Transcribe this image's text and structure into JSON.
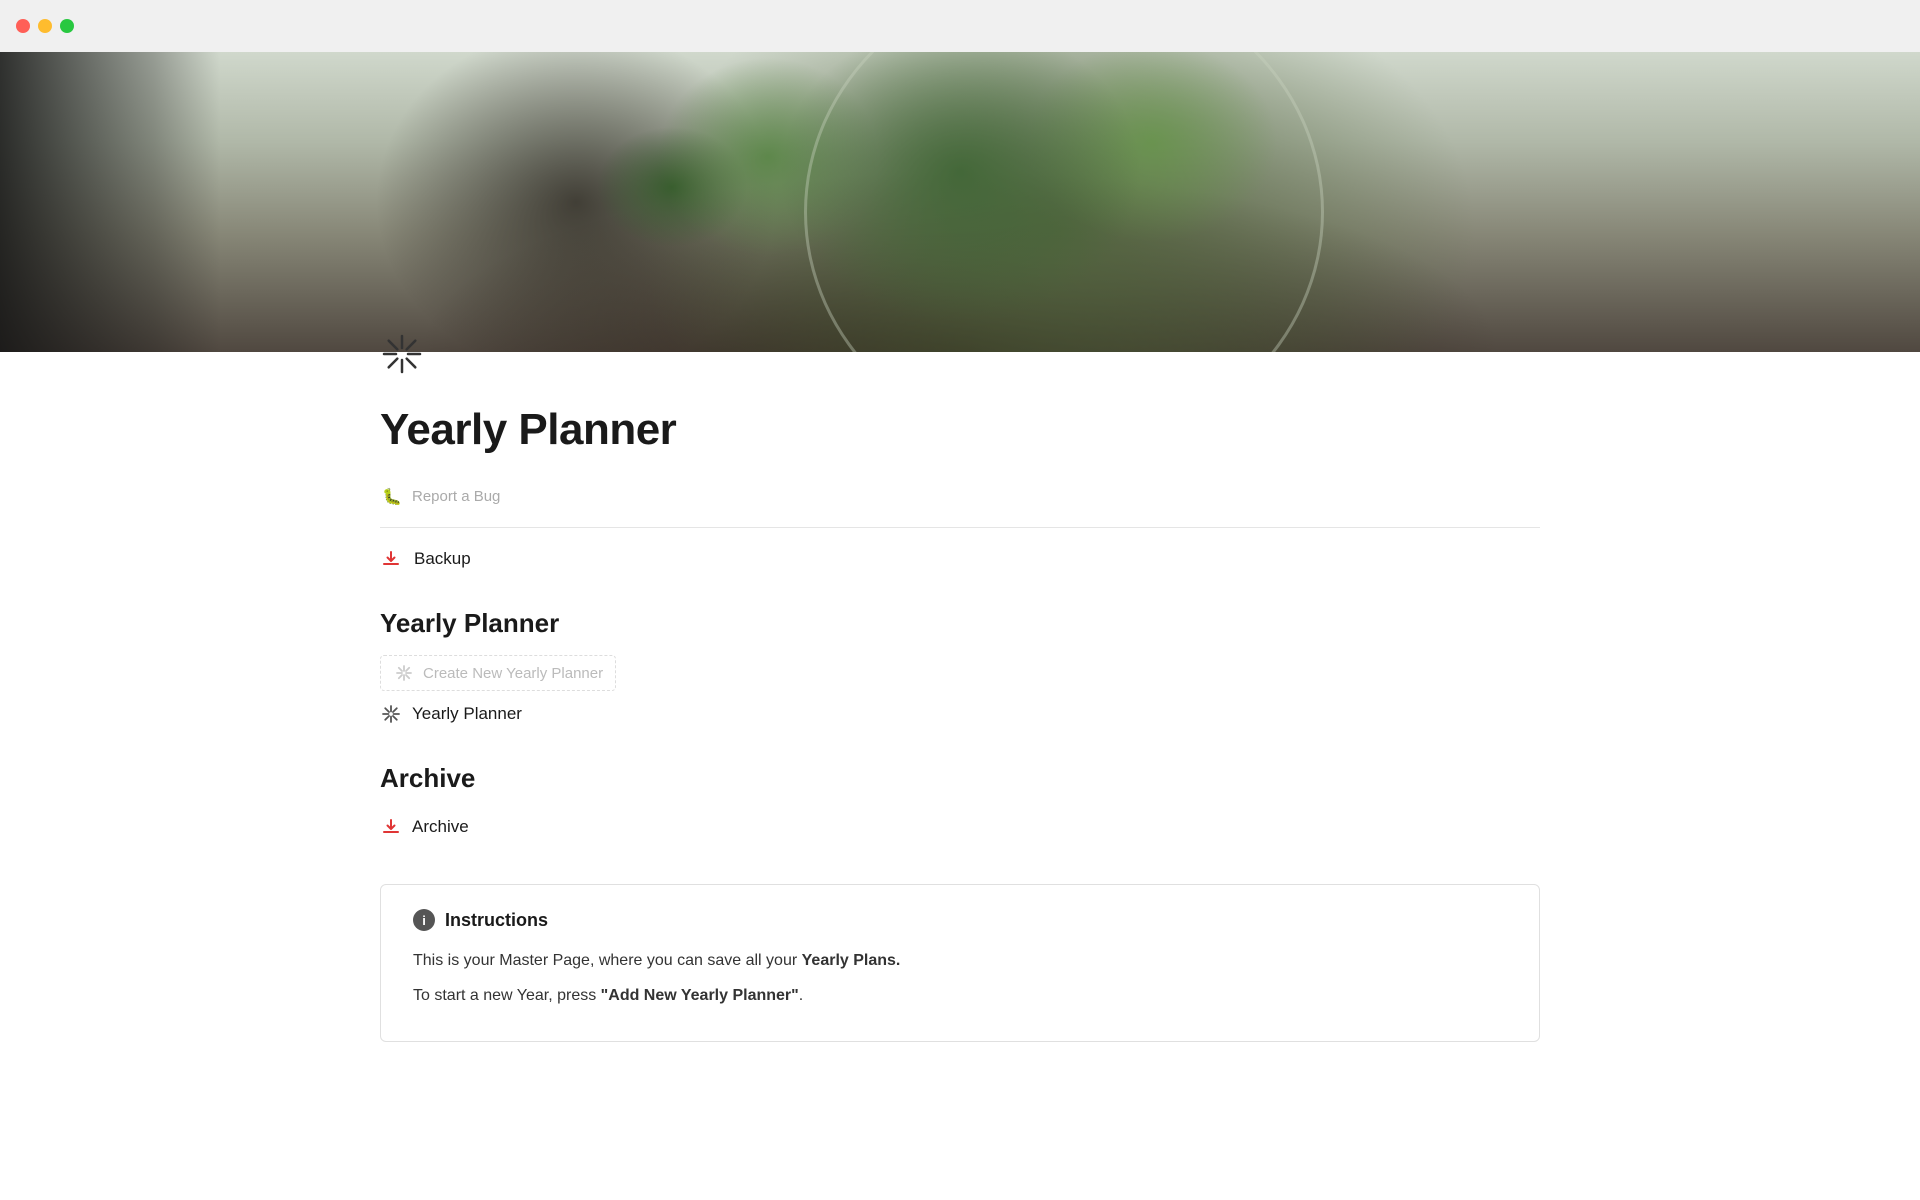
{
  "titlebar": {
    "traffic_lights": [
      "close",
      "minimize",
      "maximize"
    ]
  },
  "page": {
    "title": "Yearly Planner",
    "icon_type": "sunburst"
  },
  "sections": {
    "report_bug": {
      "icon": "bug-icon",
      "label": "Report a Bug"
    },
    "backup": {
      "icon": "download-icon",
      "label": "Backup"
    },
    "yearly_planner": {
      "heading": "Yearly Planner",
      "create_new_label": "Create New Yearly Planner",
      "item_label": "Yearly Planner"
    },
    "archive": {
      "heading": "Archive",
      "item_label": "Archive"
    }
  },
  "instructions": {
    "heading": "Instructions",
    "line1_prefix": "This is your Master Page, where you can save all your ",
    "line1_bold": "Yearly Plans.",
    "line2_prefix": "To start a new Year, press ",
    "line2_bold": "\"Add New Yearly Planner\"",
    "line2_suffix": "."
  }
}
